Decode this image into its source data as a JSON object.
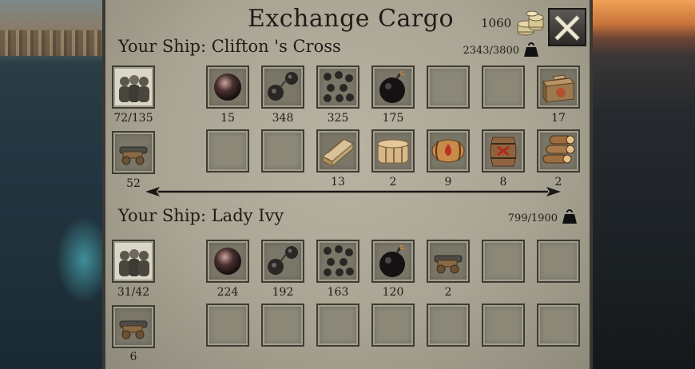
{
  "title": "Exchange Cargo",
  "gold": "1060",
  "ship1": {
    "name": "Your Ship: Clifton 's Cross",
    "weight": "2343/3800",
    "crew": "72/135",
    "cannons": "52",
    "row1": [
      {
        "icon": "cannonball-round-icon",
        "count": "15"
      },
      {
        "icon": "chain-shot-icon",
        "count": "348"
      },
      {
        "icon": "grapeshot-icon",
        "count": "325"
      },
      {
        "icon": "bomb-icon",
        "count": "175"
      },
      {
        "icon": "",
        "count": ""
      },
      {
        "icon": "",
        "count": ""
      },
      {
        "icon": "crate-icon",
        "count": "17"
      }
    ],
    "row2": [
      {
        "icon": "",
        "count": ""
      },
      {
        "icon": "",
        "count": ""
      },
      {
        "icon": "planks-icon",
        "count": "13"
      },
      {
        "icon": "sail-cloth-icon",
        "count": "2"
      },
      {
        "icon": "rum-barrel-icon",
        "count": "9"
      },
      {
        "icon": "gunpowder-barrel-icon",
        "count": "8"
      },
      {
        "icon": "logs-icon",
        "count": "2"
      }
    ]
  },
  "ship2": {
    "name": "Your Ship: Lady Ivy",
    "weight": "799/1900",
    "crew": "31/42",
    "cannons": "6",
    "row1": [
      {
        "icon": "cannonball-round-icon",
        "count": "224"
      },
      {
        "icon": "chain-shot-icon",
        "count": "192"
      },
      {
        "icon": "grapeshot-icon",
        "count": "163"
      },
      {
        "icon": "bomb-icon",
        "count": "120"
      },
      {
        "icon": "cannon-icon",
        "count": "2"
      },
      {
        "icon": "",
        "count": ""
      },
      {
        "icon": "",
        "count": ""
      }
    ],
    "row2": [
      {
        "icon": "",
        "count": ""
      },
      {
        "icon": "",
        "count": ""
      },
      {
        "icon": "",
        "count": ""
      },
      {
        "icon": "",
        "count": ""
      },
      {
        "icon": "",
        "count": ""
      },
      {
        "icon": "",
        "count": ""
      },
      {
        "icon": "",
        "count": ""
      }
    ]
  }
}
